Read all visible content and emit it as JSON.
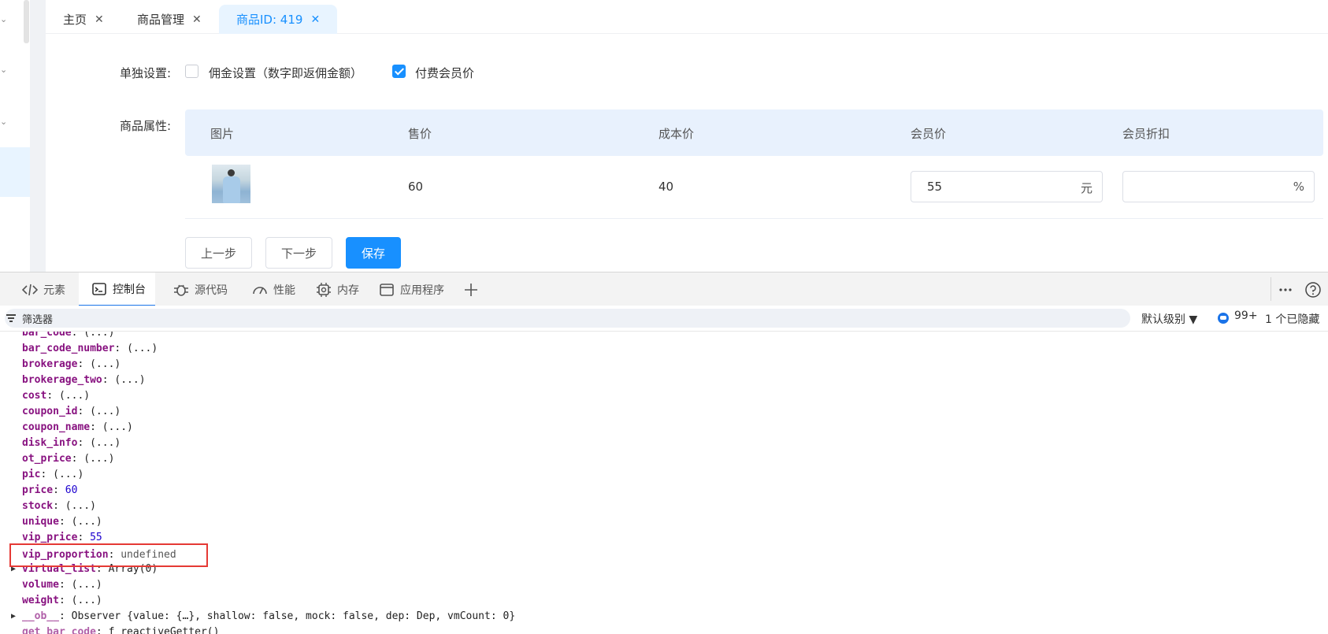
{
  "tabs": [
    {
      "label": "主页",
      "close": "✕"
    },
    {
      "label": "商品管理",
      "close": "✕"
    },
    {
      "label": "商品ID: 419",
      "close": "✕"
    }
  ],
  "form": {
    "individual_label": "单独设置:",
    "commission_option": "佣金设置（数字即返佣金额）",
    "member_price_option": "付费会员价",
    "member_price_checked": true,
    "commission_checked": false,
    "attr_label": "商品属性:"
  },
  "table": {
    "headers": [
      "图片",
      "售价",
      "成本价",
      "会员价",
      "会员折扣"
    ],
    "row": {
      "price": "60",
      "cost": "40",
      "vip_price": "55",
      "vip_price_suffix": "元",
      "vip_discount": "",
      "vip_discount_suffix": "%"
    }
  },
  "buttons": {
    "prev": "上一步",
    "next": "下一步",
    "save": "保存"
  },
  "devtools": {
    "tabs": [
      "元素",
      "控制台",
      "源代码",
      "性能",
      "内存",
      "应用程序"
    ],
    "active_tab": "控制台",
    "filter_placeholder": "筛选器",
    "level": "默认级别",
    "message_count": "99+",
    "hidden": "1 个已隐藏",
    "accent": "#1a73e8"
  },
  "console": {
    "lines": [
      {
        "key": "bar_code",
        "val": "(...)"
      },
      {
        "key": "bar_code_number",
        "val": "(...)"
      },
      {
        "key": "brokerage",
        "val": "(...)"
      },
      {
        "key": "brokerage_two",
        "val": "(...)"
      },
      {
        "key": "cost",
        "val": "(...)"
      },
      {
        "key": "coupon_id",
        "val": "(...)"
      },
      {
        "key": "coupon_name",
        "val": "(...)"
      },
      {
        "key": "disk_info",
        "val": "(...)"
      },
      {
        "key": "ot_price",
        "val": "(...)"
      },
      {
        "key": "pic",
        "val": "(...)"
      },
      {
        "key": "price",
        "val": "60"
      },
      {
        "key": "stock",
        "val": "(...)"
      },
      {
        "key": "unique",
        "val": "(...)"
      },
      {
        "key": "vip_price",
        "val": "55"
      },
      {
        "key": "vip_proportion",
        "val": "undefined"
      },
      {
        "key": "virtual_list",
        "val": "Array(0)"
      },
      {
        "key": "volume",
        "val": "(...)"
      },
      {
        "key": "weight",
        "val": "(...)"
      },
      {
        "key": "__ob__",
        "val": "Observer {value: {…}, shallow: false, mock: false, dep: Dep, vmCount: 0}"
      },
      {
        "key": "get bar_code",
        "val": "ƒ reactiveGetter()"
      }
    ]
  }
}
